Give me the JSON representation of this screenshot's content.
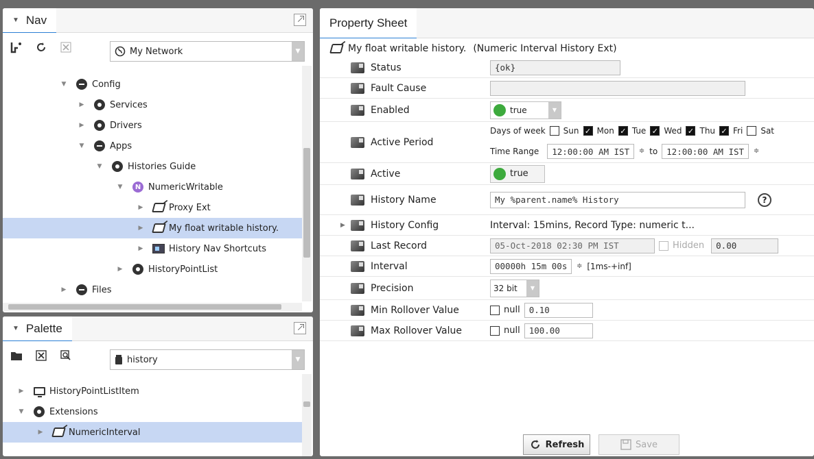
{
  "nav": {
    "title": "Nav",
    "station": "My Network",
    "tree": [
      {
        "label": "Config"
      },
      {
        "label": "Services"
      },
      {
        "label": "Drivers"
      },
      {
        "label": "Apps"
      },
      {
        "label": "Histories Guide"
      },
      {
        "label": "NumericWritable"
      },
      {
        "label": "Proxy Ext"
      },
      {
        "label": "My float writable history."
      },
      {
        "label": "History Nav Shortcuts"
      },
      {
        "label": "HistoryPointList"
      },
      {
        "label": "Files"
      }
    ]
  },
  "palette": {
    "title": "Palette",
    "module": "history",
    "items": [
      {
        "label": "HistoryPointListItem"
      },
      {
        "label": "Extensions"
      },
      {
        "label": "NumericInterval"
      }
    ]
  },
  "property_sheet": {
    "tab_title": "Property Sheet",
    "header_name": "My float writable history.",
    "header_type": "(Numeric Interval History Ext)",
    "status": {
      "label": "Status",
      "value": "{ok}"
    },
    "fault_cause": {
      "label": "Fault Cause",
      "value": ""
    },
    "enabled": {
      "label": "Enabled",
      "value": "true"
    },
    "active_period": {
      "label": "Active Period",
      "days_label": "Days of week",
      "days": [
        "Sun",
        "Mon",
        "Tue",
        "Wed",
        "Thu",
        "Fri",
        "Sat"
      ],
      "days_checked": [
        false,
        true,
        true,
        true,
        true,
        true,
        false
      ],
      "time_range_label": "Time Range",
      "from": "12:00:00 AM IST",
      "to_label": "to",
      "to": "12:00:00 AM IST"
    },
    "active": {
      "label": "Active",
      "value": "true"
    },
    "history_name": {
      "label": "History Name",
      "value": "My %parent.name% History"
    },
    "history_config": {
      "label": "History Config",
      "value": "Interval: 15mins, Record Type: numeric t..."
    },
    "last_record": {
      "label": "Last Record",
      "value": "05-Oct-2018 02:30 PM IST",
      "hidden_label": "Hidden",
      "number": "0.00"
    },
    "interval": {
      "label": "Interval",
      "value": "00000h 15m 00s",
      "range": "[1ms-+inf]"
    },
    "precision": {
      "label": "Precision",
      "value": "32 bit"
    },
    "min_rollover": {
      "label": "Min Rollover Value",
      "null_label": "null",
      "value": "0.10"
    },
    "max_rollover": {
      "label": "Max Rollover Value",
      "null_label": "null",
      "value": "100.00"
    },
    "refresh_label": "Refresh",
    "save_label": "Save"
  },
  "colors": {
    "selection": "#c7d7f3",
    "accent": "#2a7fd4",
    "ok_green": "#3daa3d"
  }
}
